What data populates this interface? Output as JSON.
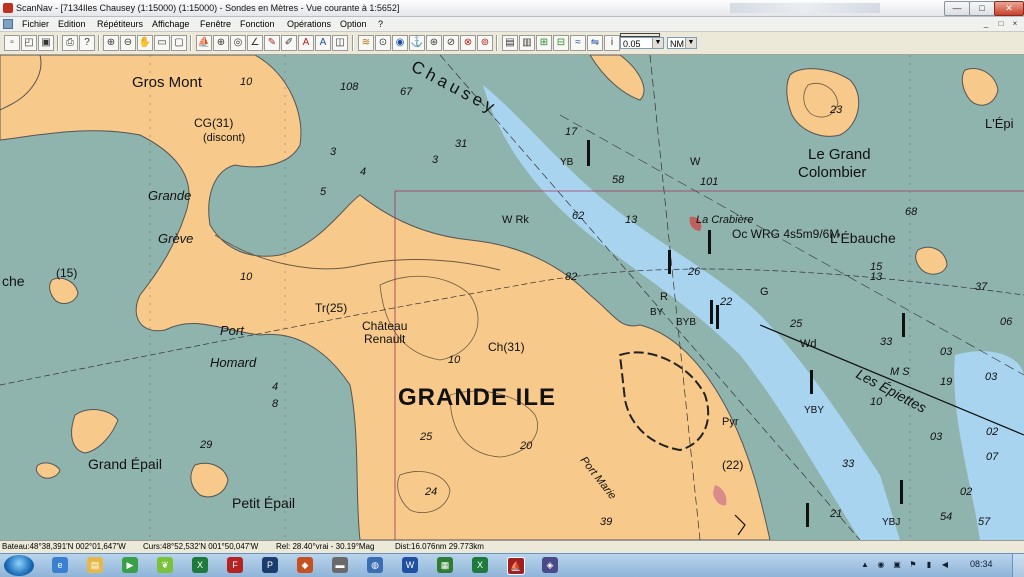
{
  "window": {
    "title": "ScanNav - [7134Iles Chausey (1:15000) (1:15000) - Sondes en  Mètres  - Vue courante à 1:5652]",
    "min_label": "—",
    "max_label": "□",
    "close_label": "✕"
  },
  "menubar": {
    "items": [
      "Fichier",
      "Edition",
      "Répétiteurs",
      "Affichage",
      "Fenêtre",
      "Fonction",
      "Opérations",
      "Option",
      "?"
    ],
    "mdi_buttons": [
      "_",
      "□",
      "×"
    ]
  },
  "toolbar": {
    "icons": [
      "new-icon",
      "open-icon",
      "save-icon",
      "print-icon",
      "help-cursor-icon",
      "zoom-in-icon",
      "zoom-out-icon",
      "pan-hand-icon",
      "zoom-rect-icon",
      "zoom-window-icon",
      "boat-icon",
      "crosshair-icon",
      "waypoint-icon",
      "route-icon",
      "draw-icon",
      "edit-icon",
      "text-icon",
      "copy-icon",
      "gps-icon",
      "wind-icon",
      "compass-icon",
      "target-icon",
      "anchor-icon",
      "lifebuoy-icon",
      "track-icon",
      "grid-icon",
      "tide-icon",
      "current-icon",
      "weather-icon",
      "layers-icon",
      "settings-icon"
    ],
    "scale_value": "0.05",
    "unit_value": "NM"
  },
  "map": {
    "labels": {
      "gros_mont": "Gros Mont",
      "cg31": "CG(31)",
      "discont": "(discont)",
      "grande": "Grande",
      "greve": "Grève",
      "che": "che",
      "fifteen": "(15)",
      "port": "Port",
      "homard": "Homard",
      "tr25": "Tr(25)",
      "chateau": "Château",
      "renault": "Renault",
      "ch31": "Ch(31)",
      "grande_ile": "GRANDE ILE",
      "grand_epail": "Grand Épail",
      "petit_epail": "Petit Épail",
      "port_marie": "Port Marie",
      "pyr": "Pyr",
      "pyr22": "(22)",
      "chausey": "Chausey",
      "la_crabiere": "La Crabière",
      "light": "Oc WRG 4s5m9/6M",
      "le_grand": "Le Grand",
      "colombier": "Colombier",
      "ebauche": "L'Ébauche",
      "les_epiettes": "Les Épiettes",
      "l_epi": "L'Épi",
      "wrk": "W Rk",
      "yb": "YB",
      "byb": "BYB",
      "by": "BY",
      "r": "R",
      "g": "G",
      "wd": "Wd",
      "ms": "M S",
      "w": "W",
      "ybv": "YBY",
      "ybj": "YBJ"
    },
    "depths": [
      "108",
      "67",
      "31",
      "3",
      "17",
      "58",
      "101",
      "62",
      "13",
      "26",
      "82",
      "25",
      "23",
      "24",
      "22",
      "25",
      "4",
      "8",
      "19",
      "33",
      "03",
      "02",
      "07",
      "15",
      "03",
      "54",
      "57",
      "13",
      "10",
      "10",
      "10",
      "20",
      "03",
      "39",
      "33",
      "21",
      "02",
      "37",
      "06",
      "29",
      "10",
      "3",
      "4",
      "5",
      "68"
    ],
    "colors": {
      "land": "#f7c98a",
      "sea": "#8fb3ad",
      "shallow": "#a9d4ef",
      "channel": "#a9d4ef"
    }
  },
  "statusbar": {
    "bateau": "Bateau:48°38,391'N 002°01,647'W",
    "curseur": "Curs:48°52,532'N 001°50,047'W",
    "relevement": "Rel: 28.40°vrai - 30.19°Mag",
    "distance": "Dist:16.076nm  29.773km"
  },
  "taskbar": {
    "apps": [
      "ie-icon",
      "folder-icon",
      "media-icon",
      "leaf-icon",
      "excel-icon",
      "filezilla-icon",
      "photoshop-icon",
      "shield-icon",
      "hdd-icon",
      "globe-icon",
      "word-icon",
      "chart-icon",
      "excel2-icon",
      "scannav-icon",
      "app-icon"
    ],
    "tray": [
      "arrow-up-icon",
      "eye-icon",
      "network-icon",
      "speaker-icon",
      "flag-icon",
      "battery-icon",
      "volume-icon"
    ],
    "clock": "08:34"
  }
}
